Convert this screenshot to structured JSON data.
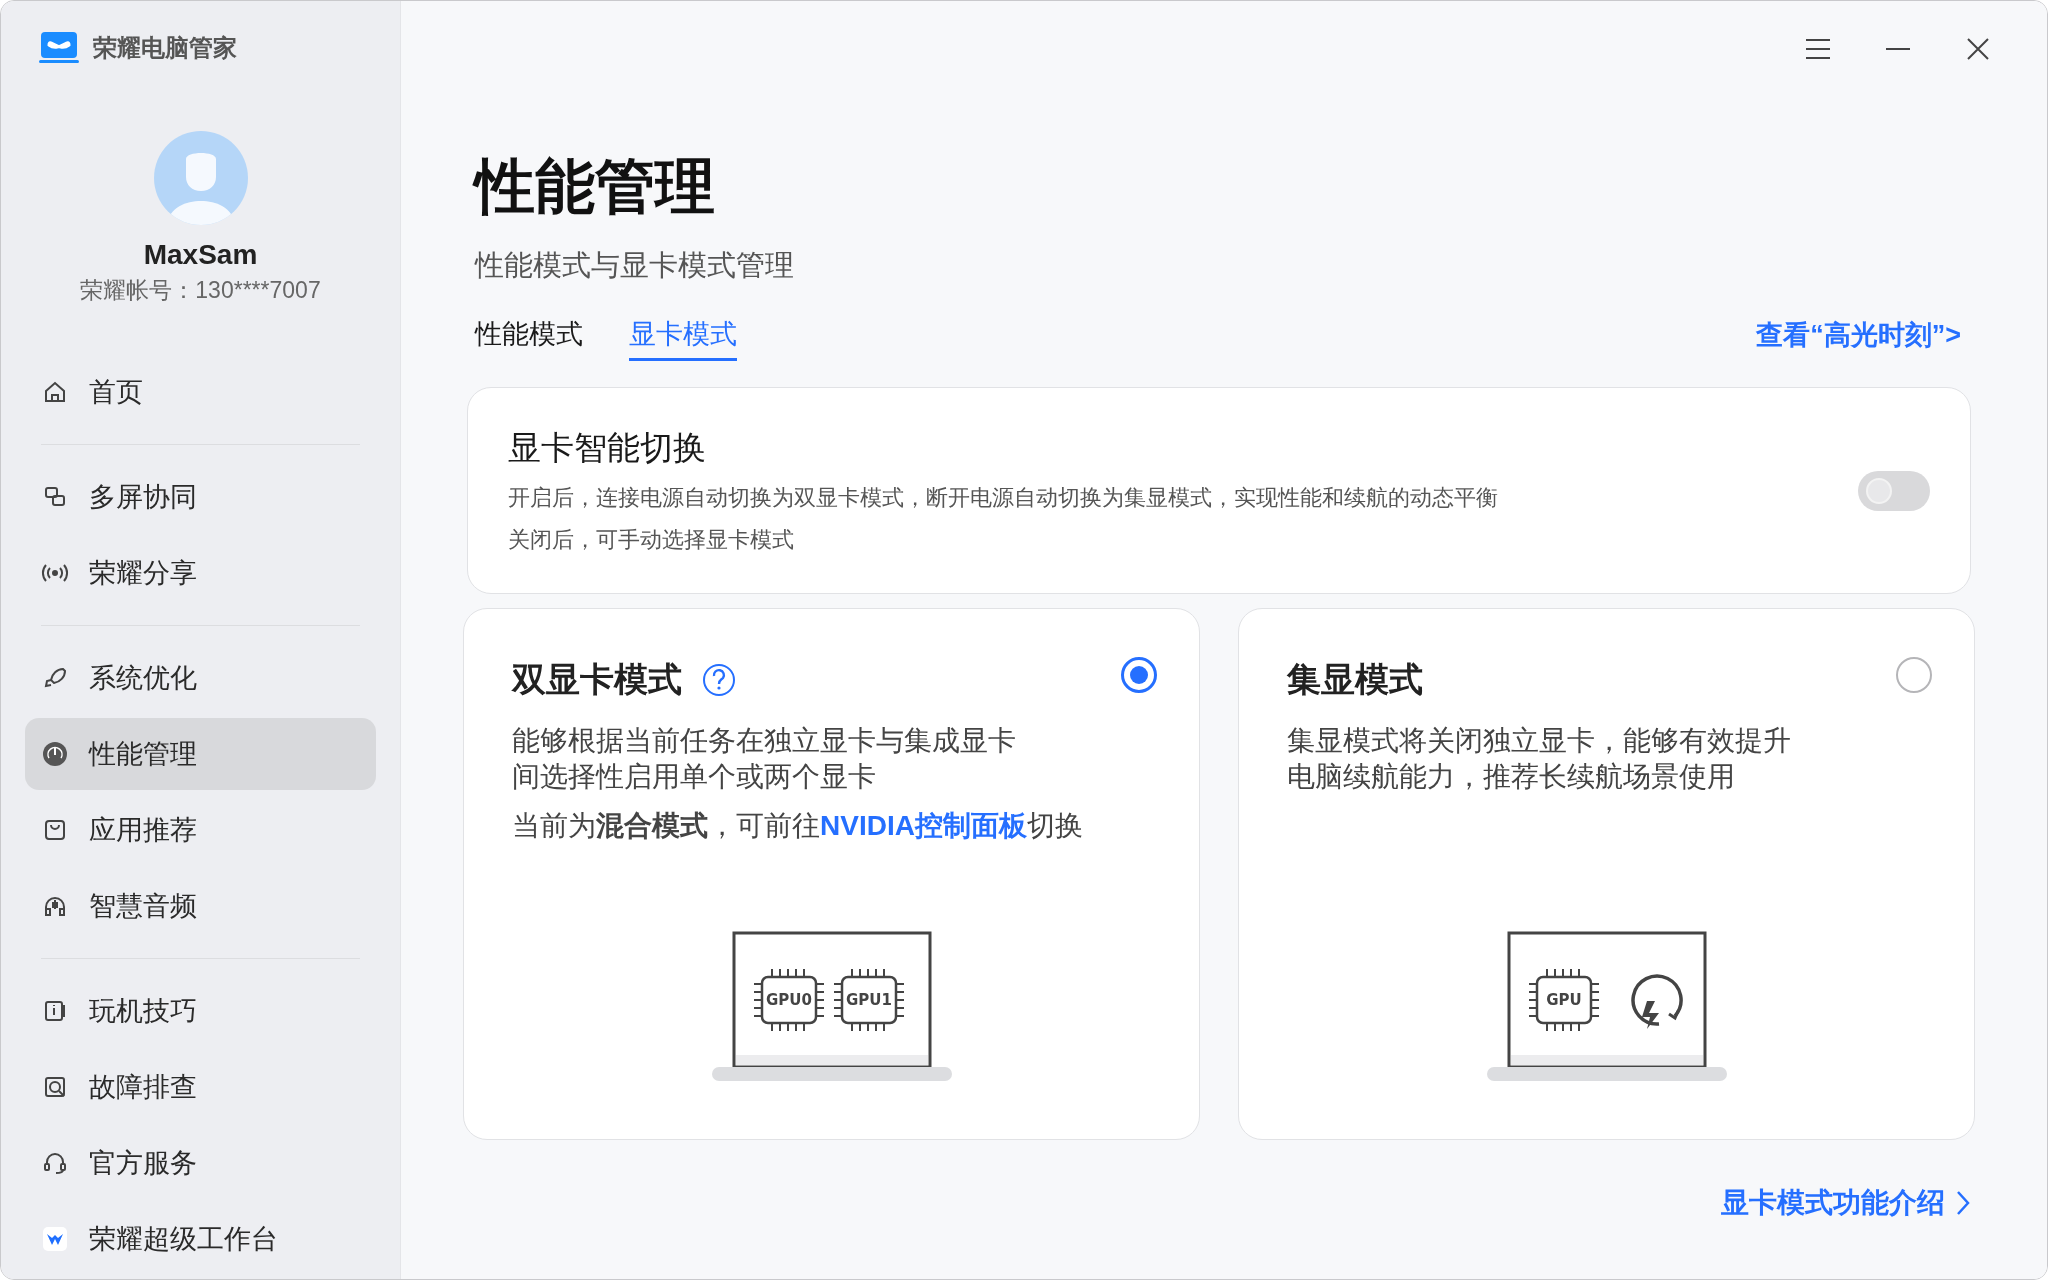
{
  "app": {
    "title": "荣耀电脑管家"
  },
  "user": {
    "name": "MaxSam",
    "account": "荣耀帐号：130****7007"
  },
  "sidebar": {
    "groups": [
      {
        "items": [
          {
            "label": "首页",
            "selected": false
          }
        ]
      },
      {
        "items": [
          {
            "label": "多屏协同",
            "selected": false
          },
          {
            "label": "荣耀分享",
            "selected": false
          }
        ]
      },
      {
        "items": [
          {
            "label": "系统优化",
            "selected": false
          },
          {
            "label": "性能管理",
            "selected": true
          },
          {
            "label": "应用推荐",
            "selected": false
          },
          {
            "label": "智慧音频",
            "selected": false
          }
        ]
      },
      {
        "items": [
          {
            "label": "玩机技巧",
            "selected": false
          },
          {
            "label": "故障排查",
            "selected": false
          },
          {
            "label": "官方服务",
            "selected": false
          },
          {
            "label": "荣耀超级工作台",
            "selected": false
          }
        ]
      }
    ]
  },
  "page": {
    "title": "性能管理",
    "subtitle": "性能模式与显卡模式管理",
    "tabs": [
      {
        "label": "性能模式",
        "selected": false
      },
      {
        "label": "显卡模式",
        "selected": true
      }
    ],
    "highlight_link": "查看“高光时刻”>"
  },
  "smart_switch": {
    "title": "显卡智能切换",
    "lines": [
      "开启后，连接电源自动切换为双显卡模式，断开电源自动切换为集显模式，实现性能和续航的动态平衡",
      "关闭后，可手动选择显卡模式"
    ],
    "on": false
  },
  "modes": [
    {
      "title": "双显卡模式",
      "help": true,
      "selected": true,
      "description": "能够根据当前任务在独立显卡与集成显卡间选择性启用单个或两个显卡",
      "note": {
        "before": "当前为**混合模式**，可前往",
        "link": "NVIDIA控制面板",
        "after": "切换"
      },
      "chips": [
        "GPU0",
        "GPU1"
      ],
      "power": false
    },
    {
      "title": "集显模式",
      "help": false,
      "selected": false,
      "description": "集显模式将关闭独立显卡，能够有效提升电脑续航能力，推荐长续航场景使用",
      "chips": [
        "GPU"
      ],
      "power": true
    }
  ],
  "footer_link": "显卡模式功能介绍"
}
